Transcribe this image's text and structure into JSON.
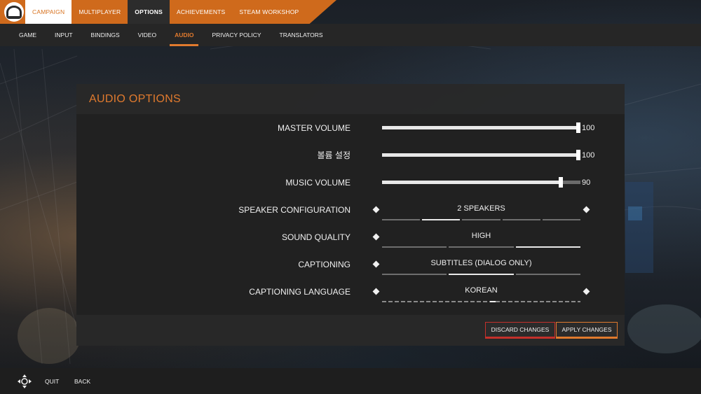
{
  "nav": {
    "main_tabs": [
      {
        "label": "CAMPAIGN"
      },
      {
        "label": "MULTIPLAYER"
      },
      {
        "label": "OPTIONS"
      },
      {
        "label": "ACHIEVEMENTS"
      },
      {
        "label": "STEAM WORKSHOP"
      }
    ],
    "sub_tabs": [
      {
        "label": "GAME"
      },
      {
        "label": "INPUT"
      },
      {
        "label": "BINDINGS"
      },
      {
        "label": "VIDEO"
      },
      {
        "label": "AUDIO"
      },
      {
        "label": "PRIVACY POLICY"
      },
      {
        "label": "TRANSLATORS"
      }
    ]
  },
  "panel": {
    "title": "AUDIO OPTIONS",
    "sliders": [
      {
        "label": "MASTER VOLUME",
        "value": "100",
        "level": 1.0
      },
      {
        "label": "볼륨 설정",
        "value": "100",
        "level": 1.0
      },
      {
        "label": "MUSIC VOLUME",
        "value": "90",
        "level": 0.9
      }
    ],
    "selectors": [
      {
        "label": "SPEAKER CONFIGURATION",
        "value": "2 SPEAKERS",
        "segments": 5,
        "selected": 1,
        "arrows": true,
        "style": "segments"
      },
      {
        "label": "SOUND QUALITY",
        "value": "HIGH",
        "segments": 3,
        "selected": 2,
        "arrows": true,
        "style": "segments"
      },
      {
        "label": "CAPTIONING",
        "value": "SUBTITLES (DIALOG ONLY)",
        "segments": 3,
        "selected": 1,
        "arrows": true,
        "style": "segments"
      },
      {
        "label": "CAPTIONING LANGUAGE",
        "value": "KOREAN",
        "arrows": true,
        "style": "dashed",
        "marker": 0.56
      }
    ],
    "buttons": {
      "discard": "DISCARD CHANGES",
      "apply": "APPLY CHANGES"
    }
  },
  "bottom": {
    "quit": "QUIT",
    "back": "BACK"
  },
  "colors": {
    "accent": "#e07a2e",
    "discard_border": "#c4302b"
  }
}
